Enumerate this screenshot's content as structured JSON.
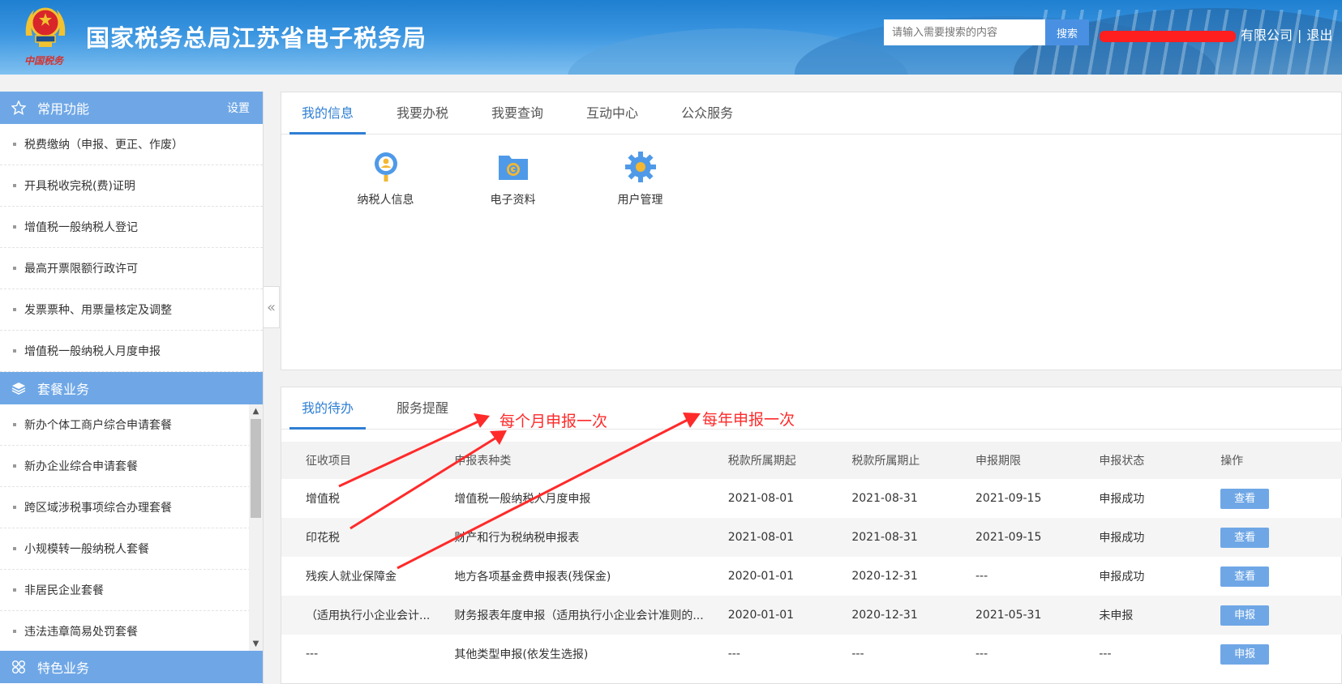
{
  "header": {
    "emblem_caption": "中国税务",
    "site_title": "国家税务总局江苏省电子税务局",
    "search_placeholder": "请输入需要搜索的内容",
    "search_button": "搜索",
    "user_company": "有限公司",
    "separator": "|",
    "logout": "退出"
  },
  "sidebar": {
    "common": {
      "title": "常用功能",
      "setting": "设置",
      "items": [
        "税费缴纳（申报、更正、作废）",
        "开具税收完税(费)证明",
        "增值税一般纳税人登记",
        "最高开票限额行政许可",
        "发票票种、用票量核定及调整",
        "增值税一般纳税人月度申报"
      ]
    },
    "package": {
      "title": "套餐业务",
      "items": [
        "新办个体工商户综合申请套餐",
        "新办企业综合申请套餐",
        "跨区域涉税事项综合办理套餐",
        "小规模转一般纳税人套餐",
        "非居民企业套餐",
        "违法违章简易处罚套餐"
      ]
    },
    "special": {
      "title": "特色业务"
    }
  },
  "info_panel": {
    "tabs": [
      "我的信息",
      "我要办税",
      "我要查询",
      "互动中心",
      "公众服务"
    ],
    "icons": [
      {
        "label": "纳税人信息",
        "icon": "taxpayer-info-icon"
      },
      {
        "label": "电子资料",
        "icon": "e-document-icon"
      },
      {
        "label": "用户管理",
        "icon": "user-management-icon"
      }
    ]
  },
  "todo_panel": {
    "tabs": [
      "我的待办",
      "服务提醒"
    ],
    "columns": [
      "征收项目",
      "申报表种类",
      "税款所属期起",
      "税款所属期止",
      "申报期限",
      "申报状态",
      "操作"
    ],
    "rows": [
      [
        "增值税",
        "增值税一般纳税人月度申报",
        "2021-08-01",
        "2021-08-31",
        "2021-09-15",
        "申报成功",
        "查看"
      ],
      [
        "印花税",
        "财产和行为税纳税申报表",
        "2021-08-01",
        "2021-08-31",
        "2021-09-15",
        "申报成功",
        "查看"
      ],
      [
        "残疾人就业保障金",
        "地方各项基金费申报表(残保金)",
        "2020-01-01",
        "2020-12-31",
        "---",
        "申报成功",
        "查看"
      ],
      [
        "（适用执行小企业会计...",
        "财务报表年度申报（适用执行小企业会计准则的...",
        "2020-01-01",
        "2020-12-31",
        "2021-05-31",
        "未申报",
        "申报"
      ],
      [
        "---",
        "其他类型申报(依发生选报)",
        "---",
        "---",
        "---",
        "---",
        "申报"
      ]
    ]
  },
  "annotations": {
    "monthly": "每个月申报一次",
    "yearly": "每年申报一次",
    "color": "#ff2a2a"
  },
  "colors": {
    "header_blue": "#1f7fd0",
    "sidebar_head": "#6fa7e6",
    "tab_active": "#2e7fd4",
    "button": "#6fa7e6"
  }
}
